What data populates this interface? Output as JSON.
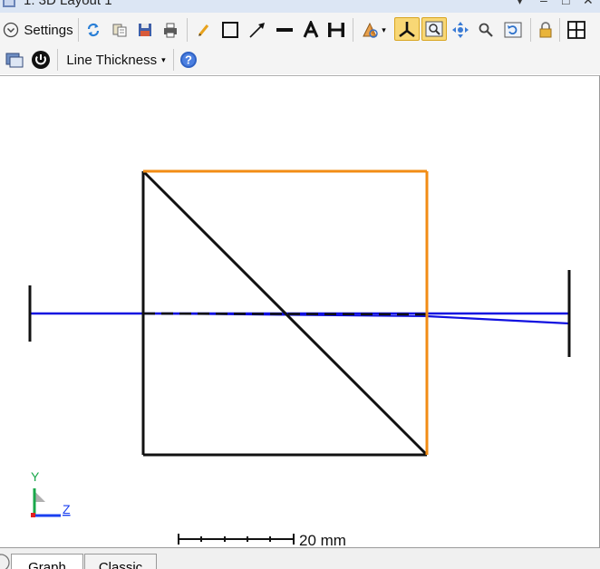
{
  "window": {
    "title": "1: 3D Layout 1",
    "controls": [
      "▾",
      "–",
      "□",
      "✕"
    ]
  },
  "toolbar": {
    "settings_label": "Settings",
    "line_thickness_label": "Line Thickness",
    "icons": [
      "refresh-icon",
      "copy-icon",
      "save-icon",
      "print-icon",
      "pencil-icon",
      "rectangle-icon",
      "arrow-icon",
      "line-icon",
      "text-icon",
      "dimension-icon",
      "rotate-view-icon",
      "axes-icon",
      "zoom-window-icon",
      "pan-icon",
      "zoom-icon",
      "reset-view-icon",
      "lock-icon",
      "fit-icon",
      "window-icon",
      "power-icon",
      "help-icon"
    ]
  },
  "viewport": {
    "axis_y_label": "Y",
    "axis_z_label": "Z",
    "scale_label": "20 mm",
    "colors": {
      "system": "#000000",
      "selected_surface": "#f28c14",
      "rays": "#1010e0",
      "axis_y": "#19a84a",
      "axis_z": "#1a3ff0",
      "axis_x": "#e02020"
    }
  },
  "tabs": [
    {
      "label": "Graph",
      "active": true
    },
    {
      "label": "Classic",
      "active": false
    }
  ]
}
